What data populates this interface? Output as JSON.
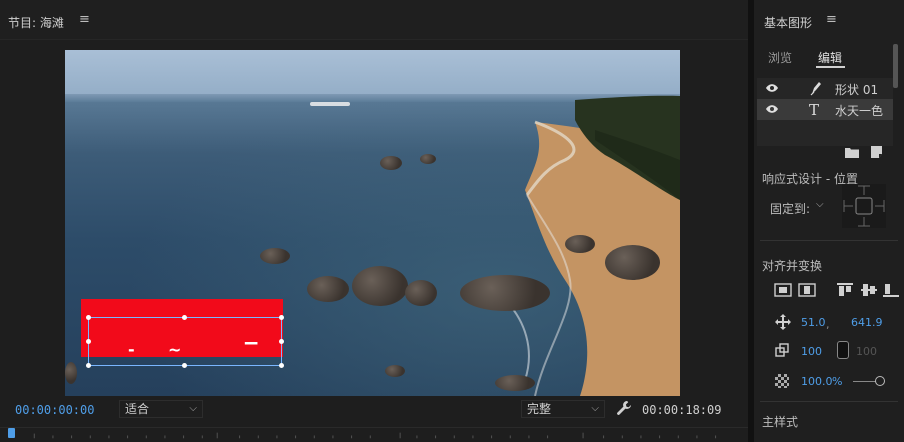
{
  "monitor": {
    "title": "节目: 海滩",
    "menu_glyph": "≡",
    "timecode_current": "00:00:00:00",
    "fit_select": "适合",
    "quality_select": "完整",
    "timecode_duration": "00:00:18:09"
  },
  "graphics_panel": {
    "title": "基本图形",
    "menu_glyph": "≡",
    "tabs": [
      {
        "label": "浏览",
        "active": false
      },
      {
        "label": "编辑",
        "active": true
      }
    ],
    "layers": [
      {
        "name": "形状 01",
        "type_icon": "pen-icon",
        "visible": true,
        "selected": false
      },
      {
        "name": "水天一色",
        "type_icon": "text-icon",
        "visible": true,
        "selected": true
      }
    ],
    "responsive_label": "响应式设计 - 位置",
    "pin_label": "固定到:",
    "align_label": "对齐并变换",
    "position_x": "51.0",
    "position_sep": ",",
    "position_y": "641.9",
    "scale": "100",
    "scale_linked": "100",
    "opacity": "100.0",
    "opacity_unit": "%",
    "master_style_label": "主样式"
  },
  "colors": {
    "accent_blue": "#4f9ee8",
    "shape_red": "#f20a1a",
    "panel_bg": "#1f1f1f"
  }
}
